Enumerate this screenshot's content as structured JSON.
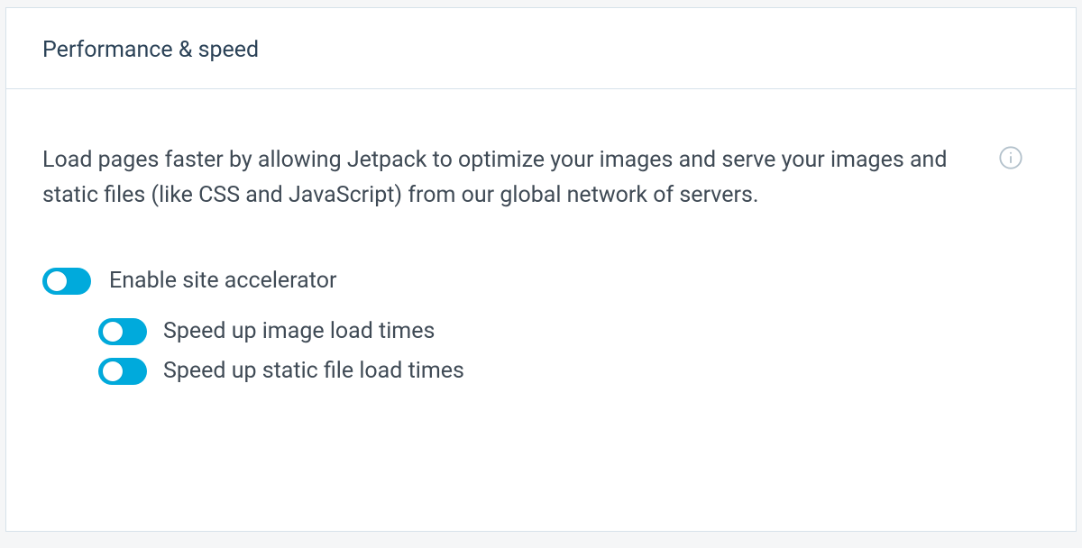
{
  "section": {
    "title": "Performance & speed",
    "description": "Load pages faster by allowing Jetpack to optimize your images and serve your images and static files (like CSS and JavaScript) from our global network of servers."
  },
  "toggles": {
    "enable_accelerator": {
      "label": "Enable site accelerator",
      "on": true
    },
    "speed_images": {
      "label": "Speed up image load times",
      "on": true
    },
    "speed_static": {
      "label": "Speed up static file load times",
      "on": true
    }
  },
  "icons": {
    "info": "info-icon"
  }
}
